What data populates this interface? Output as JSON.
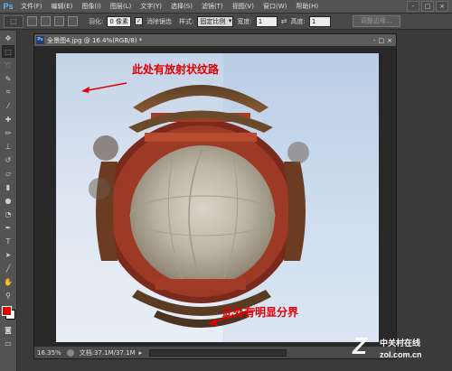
{
  "app": {
    "logo": "Ps"
  },
  "menu": [
    "文件(F)",
    "编辑(E)",
    "图像(I)",
    "图层(L)",
    "文字(Y)",
    "选择(S)",
    "滤镜(T)",
    "视图(V)",
    "窗口(W)",
    "帮助(H)"
  ],
  "window_controls": [
    "-",
    "□",
    "×"
  ],
  "options": {
    "feather_label": "羽化:",
    "feather_value": "0 像素",
    "antialias_label": "消除锯齿",
    "style_label": "样式:",
    "style_value": "固定比例",
    "width_label": "宽度:",
    "width_value": "1",
    "height_label": "高度:",
    "height_value": "1",
    "refine_edge": "调整边缘..."
  },
  "document": {
    "tab_title": "全景图4.jpg @ 16.4%(RGB/8) *",
    "controls": [
      "-",
      "□",
      "×"
    ]
  },
  "annotations": {
    "top": "此处有放射状纹路",
    "bottom": "此处有明显分界"
  },
  "status": {
    "zoom": "16.35%",
    "doc_size": "文档:37.1M/37.1M"
  },
  "colors": {
    "foreground": "#e00000",
    "background": "#ffffff",
    "annotation": "#e00000"
  },
  "watermark": {
    "logo": "Z",
    "name": "中关村在线",
    "url": "zol.com.cn"
  }
}
